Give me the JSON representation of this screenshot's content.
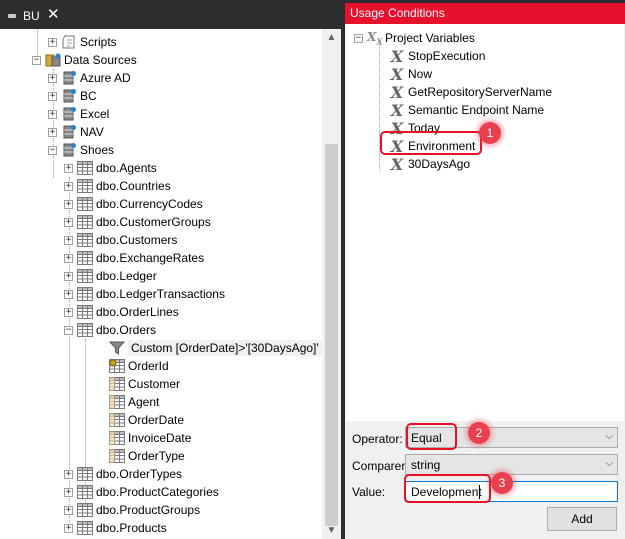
{
  "document_tab": {
    "label": "BU",
    "close_glyph": "✕"
  },
  "left_tree": {
    "rows": [
      {
        "label": "Scripts",
        "icon": "scripts-icon",
        "expander": "+"
      },
      {
        "label": "Data Sources",
        "icon": "data-sources-icon",
        "expander": "−"
      },
      {
        "label": "Azure AD",
        "icon": "datasource-icon",
        "expander": "+"
      },
      {
        "label": "BC",
        "icon": "datasource-icon",
        "expander": "+"
      },
      {
        "label": "Excel",
        "icon": "datasource-icon",
        "expander": "+"
      },
      {
        "label": "NAV",
        "icon": "datasource-icon",
        "expander": "+"
      },
      {
        "label": "Shoes",
        "icon": "datasource-icon",
        "expander": "−"
      },
      {
        "label": "dbo.Agents",
        "icon": "table-icon",
        "expander": "+"
      },
      {
        "label": "dbo.Countries",
        "icon": "table-icon",
        "expander": "+"
      },
      {
        "label": "dbo.CurrencyCodes",
        "icon": "table-icon",
        "expander": "+"
      },
      {
        "label": "dbo.CustomerGroups",
        "icon": "table-icon",
        "expander": "+"
      },
      {
        "label": "dbo.Customers",
        "icon": "table-icon",
        "expander": "+"
      },
      {
        "label": "dbo.ExchangeRates",
        "icon": "table-icon",
        "expander": "+"
      },
      {
        "label": "dbo.Ledger",
        "icon": "table-icon",
        "expander": "+"
      },
      {
        "label": "dbo.LedgerTransactions",
        "icon": "table-icon",
        "expander": "+"
      },
      {
        "label": "dbo.OrderLines",
        "icon": "table-icon",
        "expander": "+"
      },
      {
        "label": "dbo.Orders",
        "icon": "table-icon",
        "expander": "−"
      },
      {
        "label": "Custom [OrderDate]>'[30DaysAgo]'",
        "icon": "filter-icon",
        "expander": ""
      },
      {
        "label": "OrderId",
        "icon": "key-column-icon",
        "expander": ""
      },
      {
        "label": "Customer",
        "icon": "column-icon",
        "expander": ""
      },
      {
        "label": "Agent",
        "icon": "column-icon",
        "expander": ""
      },
      {
        "label": "OrderDate",
        "icon": "column-icon",
        "expander": ""
      },
      {
        "label": "InvoiceDate",
        "icon": "column-icon",
        "expander": ""
      },
      {
        "label": "OrderType",
        "icon": "column-icon",
        "expander": ""
      },
      {
        "label": "dbo.OrderTypes",
        "icon": "table-icon",
        "expander": "+"
      },
      {
        "label": "dbo.ProductCategories",
        "icon": "table-icon",
        "expander": "+"
      },
      {
        "label": "dbo.ProductGroups",
        "icon": "table-icon",
        "expander": "+"
      },
      {
        "label": "dbo.Products",
        "icon": "table-icon",
        "expander": "+"
      }
    ]
  },
  "usage_conditions": {
    "title": "Usage Conditions",
    "root": {
      "label": "Project Variables",
      "expander": "−"
    },
    "variables": [
      "StopExecution",
      "Now",
      "GetRepositoryServerName",
      "Semantic Endpoint Name",
      "Today",
      "Environment",
      "30DaysAgo"
    ],
    "variable_glyph": "X",
    "operator_label": "Operator:",
    "operator_value": "Equal",
    "comparer_label": "Comparer:",
    "comparer_value": "string",
    "value_label": "Value:",
    "value_text": "Development",
    "add_label": "Add",
    "dropdown_glyph": "⌵"
  },
  "callouts": [
    "1",
    "2",
    "3"
  ],
  "colors": {
    "title_bar": "#e8112d",
    "callout": "#e81123",
    "dark_chrome": "#2d2d30"
  }
}
